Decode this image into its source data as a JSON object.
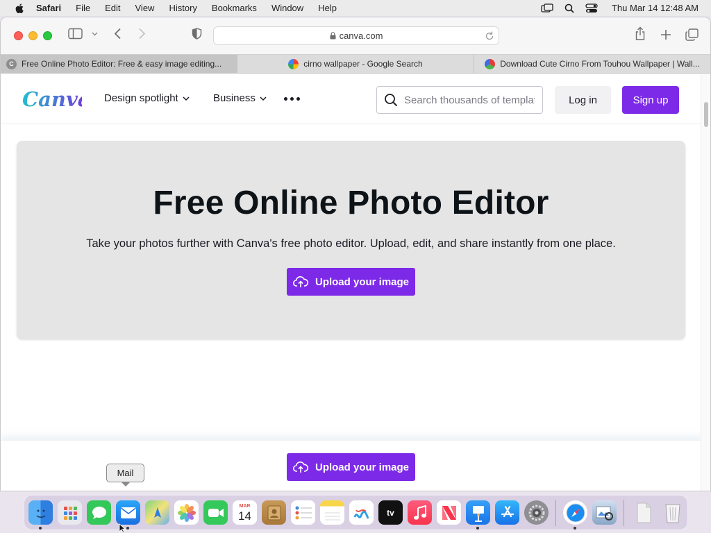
{
  "menubar": {
    "app_name": "Safari",
    "menus": [
      "File",
      "Edit",
      "View",
      "History",
      "Bookmarks",
      "Window",
      "Help"
    ],
    "clock": "Thu Mar 14  12:48 AM"
  },
  "browser": {
    "url": "canva.com",
    "tabs": [
      {
        "title": "Free Online Photo Editor: Free & easy image editing...",
        "favicon": "C",
        "active": true
      },
      {
        "title": "cirno wallpaper - Google Search",
        "favicon": "",
        "active": false
      },
      {
        "title": "Download Cute Cirno From Touhou Wallpaper | Wall...",
        "favicon": "",
        "active": false
      }
    ]
  },
  "site": {
    "logo": "Canva",
    "nav": {
      "design_spotlight": "Design spotlight",
      "business": "Business"
    },
    "search_placeholder": "Search thousands of templates",
    "login_label": "Log in",
    "signup_label": "Sign up"
  },
  "hero": {
    "title": "Free Online Photo Editor",
    "subtitle": "Take your photos further with Canva's free photo editor. Upload, edit, and share instantly from one place.",
    "upload_label": "Upload your image"
  },
  "sticky": {
    "upload_label": "Upload your image"
  },
  "tooltip": {
    "label": "Mail"
  },
  "dock": {
    "calendar_month": "MAR",
    "calendar_day": "14",
    "tv_label": "tv"
  },
  "colors": {
    "brand_purple": "#7d2ae8",
    "hero_bg": "#e5e5e5"
  }
}
